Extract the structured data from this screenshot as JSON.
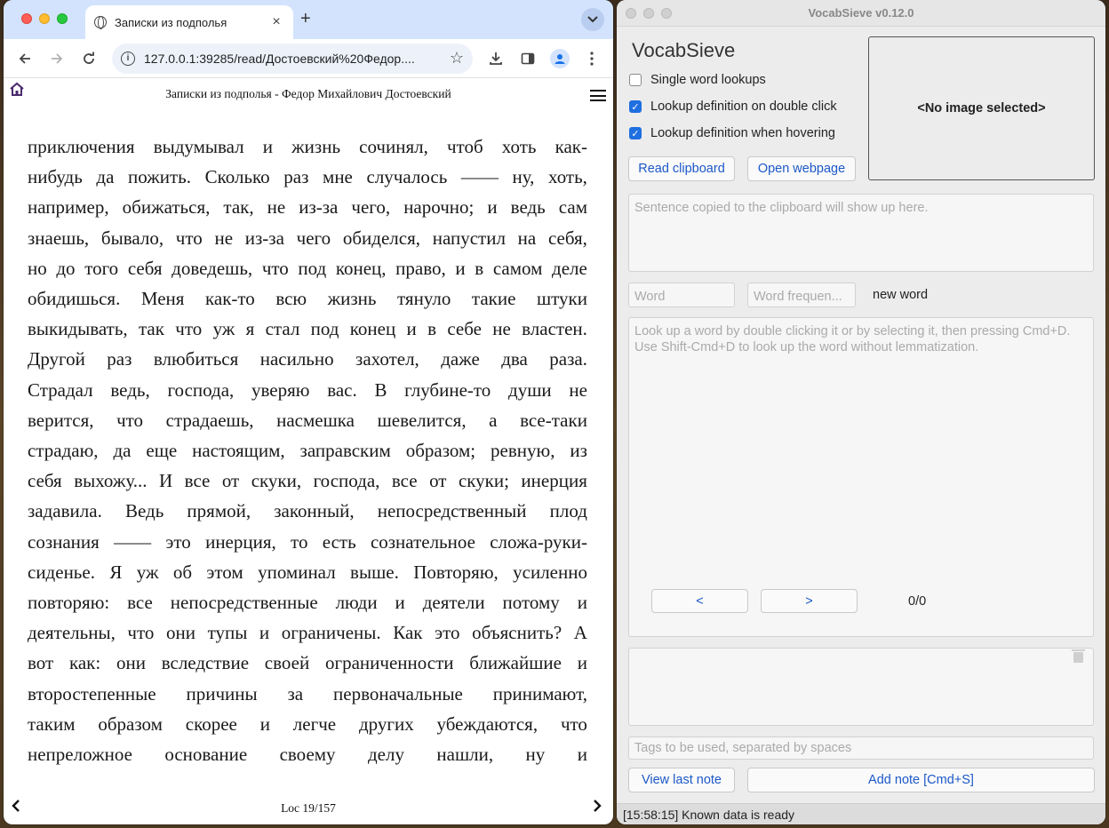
{
  "browser": {
    "tab_title": "Записки из подполья",
    "tab_close": "×",
    "new_tab": "+",
    "tab_dropdown": "⌄",
    "url": "127.0.0.1:39285/read/Достоевский%20Федор....",
    "icons": [
      "globe-icon",
      "back-icon",
      "forward-icon",
      "reload-icon",
      "info-icon",
      "star-icon",
      "download-icon",
      "sidebar-icon",
      "profile-icon",
      "menu-icon"
    ]
  },
  "reader": {
    "title": "Записки из подполья - Федор Михайлович Достоевский",
    "lines": [
      "приключения выдумывал и жизнь сочинял, чтоб хоть как-",
      "нибудь да пожить. Сколько раз мне случалось —— ну, хоть,",
      "например, обижаться, так, не из-за чего, нарочно; и ведь сам",
      "знаешь, бывало, что не из-за чего обиделся, напустил на себя,",
      "но до того себя доведешь, что под конец, право, и в самом деле",
      "обидишься. Меня как-то всю жизнь тянуло такие штуки",
      "выкидывать, так что уж я стал под конец и в себе не властен.",
      "Другой раз влюбиться насильно захотел, даже два раза.",
      "Страдал ведь, господа, уверяю вас. В глубине-то души не",
      "верится, что страдаешь, насмешка шевелится, а все-таки",
      "страдаю, да еще настоящим, заправским образом; ревную, из",
      "себя выхожу... И все от скуки, господа, все от скуки; инерция",
      "задавила. Ведь прямой, законный, непосредственный плод",
      "сознания —— это инерция, то есть сознательное сложа-руки-",
      "сиденье. Я уж об этом упоминал выше. Повторяю, усиленно",
      "повторяю: все непосредственные люди и деятели потому и",
      "деятельны, что они тупы и ограничены. Как это объяснить? А",
      "вот как: они вследствие своей ограниченности ближайшие и",
      "второстепенные причины за первоначальные принимают,",
      "таким образом скорее и легче других убеждаются, что",
      "непреложное основание своему делу нашли, ну и"
    ],
    "location": "Loc 19/157",
    "prev": "‹",
    "next": "›"
  },
  "vocab": {
    "window_title": "VocabSieve v0.12.0",
    "app_name": "VocabSieve",
    "checkboxes": [
      {
        "label": "Single word lookups",
        "checked": false
      },
      {
        "label": "Lookup definition on double click",
        "checked": true
      },
      {
        "label": "Lookup definition when hovering",
        "checked": true
      }
    ],
    "read_clipboard": "Read clipboard",
    "open_webpage": "Open webpage",
    "image_placeholder": "<No image selected>",
    "sentence_placeholder": "Sentence copied to the clipboard will show up here.",
    "word_placeholder": "Word",
    "word_freq_placeholder": "Word frequen...",
    "word_status": "new word",
    "definition_placeholder_1": "Look up a word by double clicking it or by selecting it, then pressing Cmd+D.",
    "definition_placeholder_2": "Use Shift-Cmd+D to look up the word without lemmatization.",
    "prev_def": "<",
    "next_def": ">",
    "def_counter": "0/0",
    "tags_placeholder": "Tags to be used, separated by spaces",
    "view_last_note": "View last note",
    "add_note": "Add note [Cmd+S]",
    "status": "[15:58:15] Known data is ready",
    "check_mark": "✓"
  },
  "colors": {
    "tabstrip": "#d3e3fd",
    "link_blue": "#1c58c8",
    "checkbox_blue": "#1f6fe0"
  }
}
